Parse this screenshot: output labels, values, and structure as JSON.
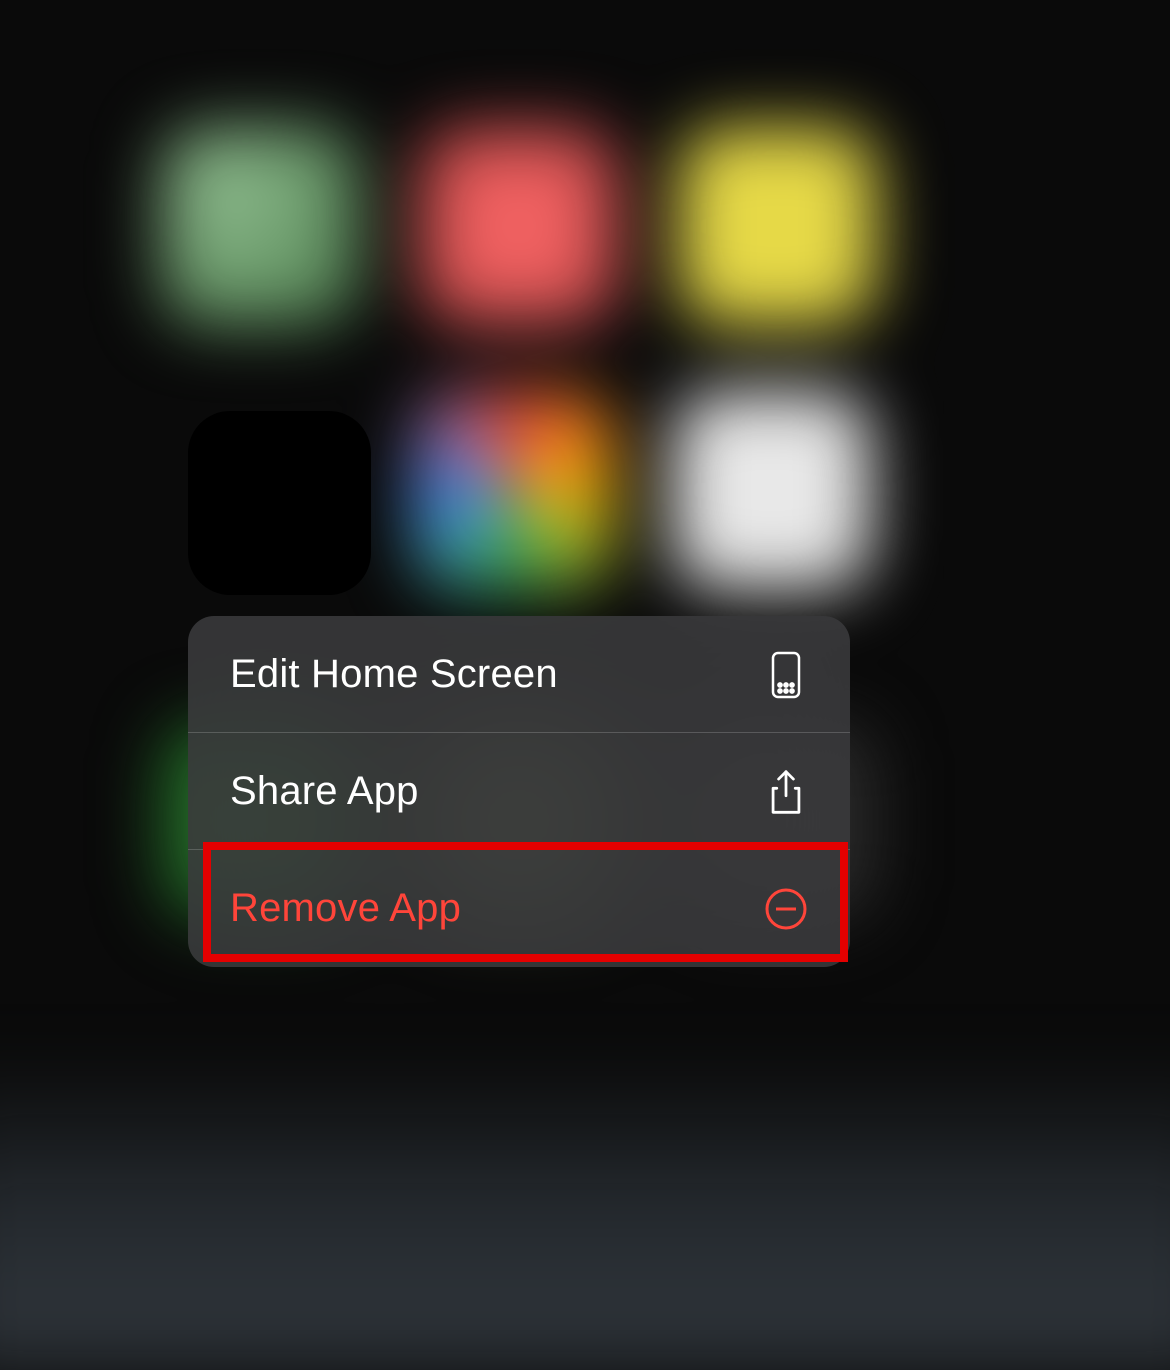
{
  "menu": {
    "items": [
      {
        "label": "Edit Home Screen",
        "icon": "home-screen-grid-icon",
        "destructive": false
      },
      {
        "label": "Share App",
        "icon": "share-icon",
        "destructive": false
      },
      {
        "label": "Remove App",
        "icon": "remove-circle-icon",
        "destructive": true
      }
    ]
  },
  "highlighted_item_index": 2,
  "colors": {
    "destructive": "#ff453a",
    "highlight_border": "#e40000",
    "menu_background": "rgba(58, 58, 60, 0.88)",
    "menu_text": "#ffffff"
  }
}
